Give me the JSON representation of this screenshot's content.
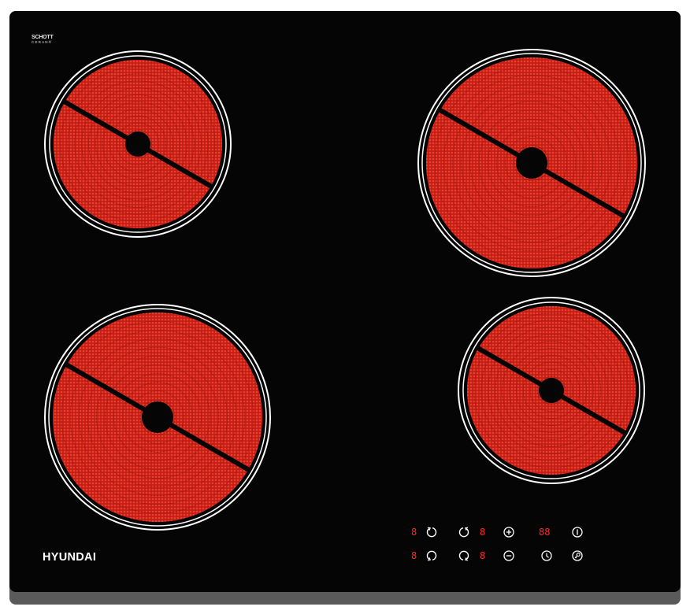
{
  "brand": "HYUNDAI",
  "glass_logo": {
    "line1": "SCHOTT",
    "line2": "CERAN®"
  },
  "colors": {
    "glass": "#050505",
    "element": "#e8291e",
    "ring": "#ffffff",
    "display": "#ff2a2a",
    "frame": "#5a5a5a"
  },
  "zones": [
    {
      "name": "rear-left",
      "size": "small"
    },
    {
      "name": "rear-right",
      "size": "large"
    },
    {
      "name": "front-left",
      "size": "large"
    },
    {
      "name": "front-right",
      "size": "small"
    }
  ],
  "control_panel": {
    "displays": {
      "zone_a": "8",
      "zone_b": "8",
      "zone_c": "8",
      "zone_d": "8",
      "timer": "88"
    },
    "keys": [
      "zone-rear-left-icon",
      "zone-rear-right-icon",
      "zone-front-left-icon",
      "zone-front-right-icon",
      "plus-icon",
      "minus-icon",
      "power-icon",
      "timer-icon",
      "lock-icon"
    ]
  }
}
